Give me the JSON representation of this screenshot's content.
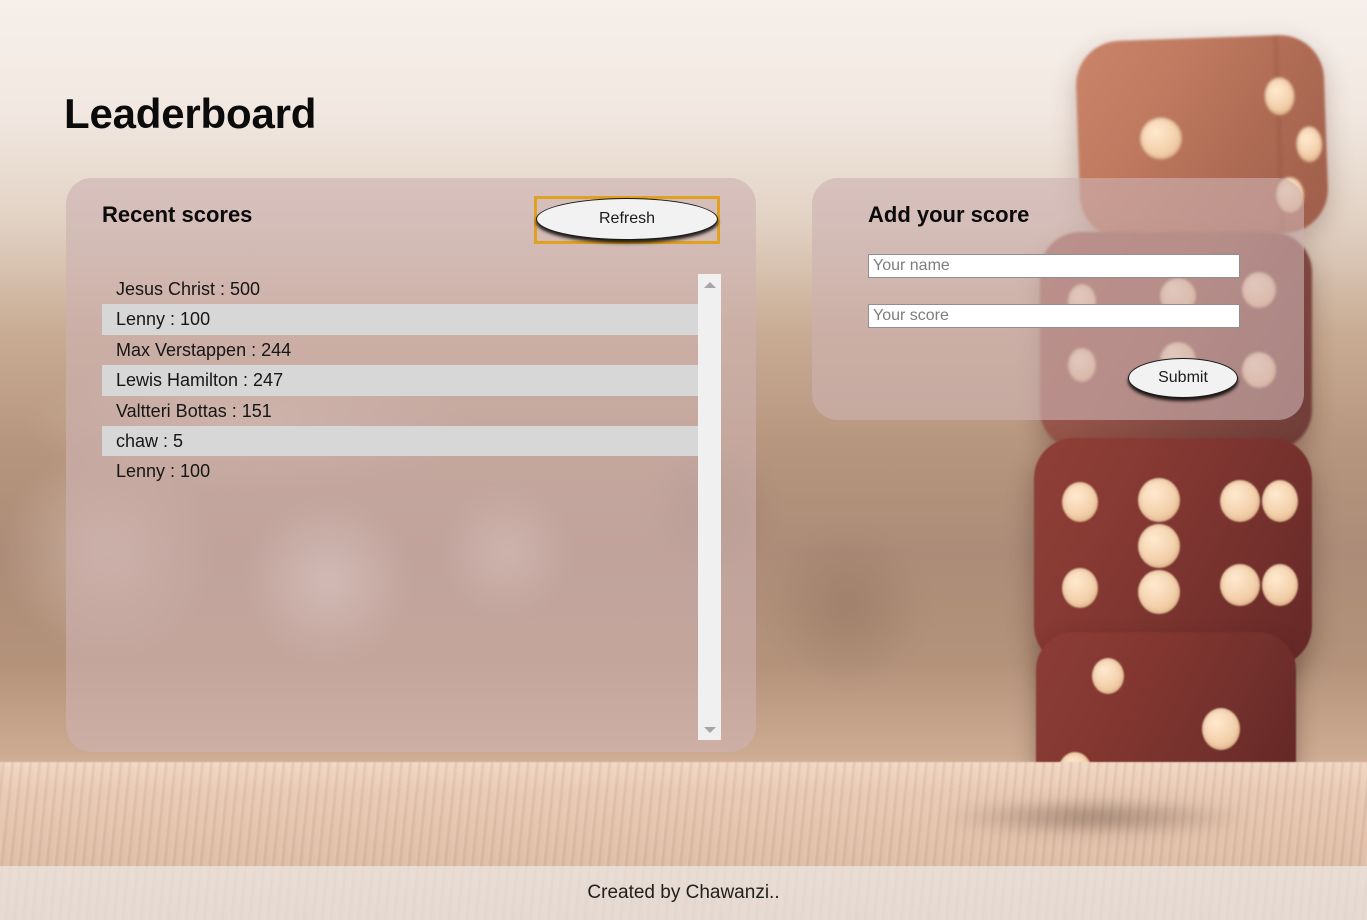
{
  "page": {
    "title": "Leaderboard"
  },
  "recent_scores_panel": {
    "heading": "Recent scores",
    "refresh_label": "Refresh",
    "entries": [
      "Jesus Christ : 500",
      "Lenny : 100",
      "Max Verstappen : 244",
      "Lewis Hamilton : 247",
      "Valtteri Bottas : 151",
      "chaw : 5",
      "Lenny : 100"
    ]
  },
  "add_score_panel": {
    "heading": "Add your score",
    "name_placeholder": "Your name",
    "name_value": "",
    "score_placeholder": "Your score",
    "score_value": "",
    "submit_label": "Submit"
  },
  "footer": {
    "text": "Created by Chawanzi.."
  },
  "colors": {
    "focus_ring": "#e0a020",
    "panel_overlay": "rgba(205,178,178,0.62)",
    "row_stripe": "#d7d7d7",
    "scrollbar_track": "#f0f0f0",
    "button_face": "#f2f2f2"
  },
  "icons": {
    "scroll_up": "scroll-up-arrow-icon",
    "scroll_down": "scroll-down-arrow-icon"
  }
}
